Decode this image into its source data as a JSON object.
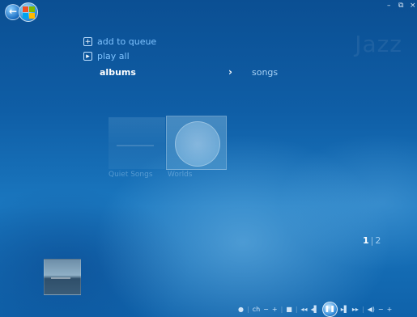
{
  "nav": {
    "back_icon": "back-arrow-icon",
    "start_icon": "windows-start-orb-icon"
  },
  "window_controls": {
    "minimize": "–",
    "restore": "⧉",
    "close": "×"
  },
  "watermark": "Jazz",
  "menu": {
    "add_to_queue": "add to queue",
    "play_all": "play all"
  },
  "breadcrumb": {
    "current": "albums",
    "arrow": "›",
    "next": "songs"
  },
  "albums": [
    {
      "title": "Quiet Songs"
    },
    {
      "title": "Worlds"
    }
  ],
  "pager": {
    "current": "1",
    "separator": "|",
    "total": "2"
  },
  "transport": {
    "dot": "●",
    "ch": "ch",
    "minus": "−",
    "plus": "+",
    "stop": "■",
    "rewind": "◂◂",
    "prev": "◂▌",
    "play_pause": "❚❚",
    "next": "▸▌",
    "fast_forward": "▸▸",
    "volume": "◀)",
    "vol_minus": "−",
    "vol_plus": "+"
  }
}
